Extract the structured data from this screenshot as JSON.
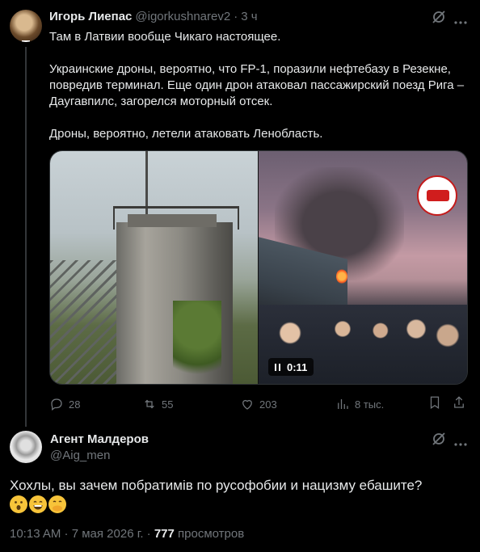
{
  "tweet": {
    "author_name": "Игорь Лиепас",
    "author_handle": "@igorkushnarev2",
    "separator": "·",
    "time": "3 ч",
    "text_p1": "Там в Латвии вообще Чикаго настоящее.",
    "text_p2": "Украинские дроны, вероятно, что FP-1, поразили нефтебазу в Резекне, повредив терминал. Еще один дрон атаковал пассажирский поезд Рига – Даугавпилс, загорелся моторный отсек.",
    "text_p3": "Дроны, вероятно, летели атаковать Ленобласть.",
    "video_duration": "0:11",
    "replies": "28",
    "reposts": "55",
    "likes": "203",
    "views": "8 тыс."
  },
  "reply": {
    "author_name": "Агент Малдеров",
    "author_handle": "@Aig_men",
    "text": "Хохлы, вы зачем побратимів по русофобии и нацизму ебашите?",
    "emojis": [
      "😯",
      "😁",
      "🤭"
    ],
    "timestamp": "10:13 AM · 7 мая 2026 г. · ",
    "view_count": "777",
    "views_label": " просмотров"
  },
  "icons": {
    "grok": "grok-icon",
    "more": "more-dots-icon",
    "reply": "reply-icon",
    "repost": "repost-icon",
    "like": "heart-icon",
    "views": "views-chart-icon",
    "bookmark": "bookmark-icon",
    "share": "share-icon"
  },
  "colors": {
    "background": "#000000",
    "text": "#e7e9ea",
    "muted": "#71767b",
    "border": "#2f3336"
  }
}
